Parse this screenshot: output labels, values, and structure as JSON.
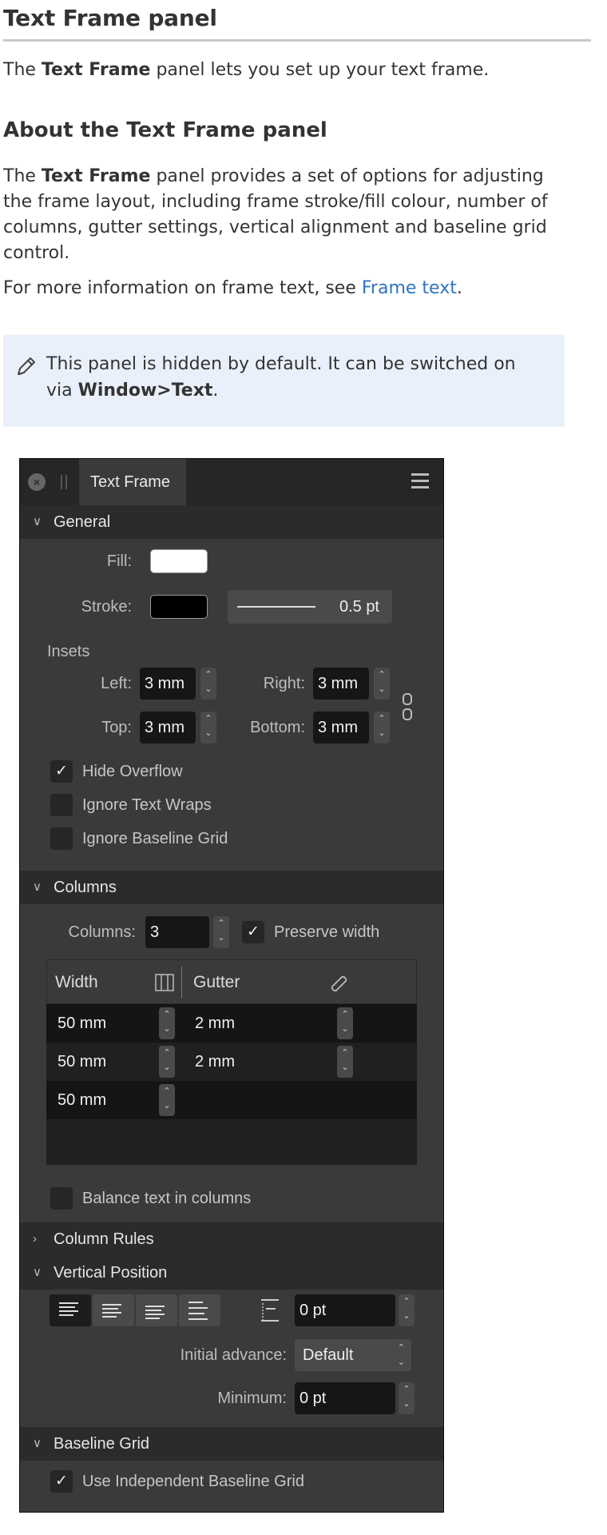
{
  "doc": {
    "title": "Text Frame panel",
    "intro_pre": "The ",
    "intro_bold": "Text Frame",
    "intro_post": " panel lets you set up your text frame.",
    "about_heading": "About the Text Frame panel",
    "about_pre": "The ",
    "about_bold": "Text Frame",
    "about_l1": " panel provides a set of options for adjusting",
    "about_l2": "the frame layout, including frame stroke/fill colour, number of",
    "about_l3": "columns, gutter settings, vertical alignment and baseline grid",
    "about_l4": "control.",
    "more_pre": "For more information on frame text, see ",
    "more_link": "Frame text",
    "more_post": ".",
    "note_l1": "This panel is hidden by default. It can be switched on",
    "note_pre": "via ",
    "note_bold": "Window>Text",
    "note_post": "."
  },
  "panel": {
    "tab_label": "Text Frame",
    "general": {
      "header": "General",
      "fill_label": "Fill:",
      "fill_color": "#ffffff",
      "stroke_label": "Stroke:",
      "stroke_color": "#000000",
      "stroke_width": "0.5 pt",
      "insets_label": "Insets",
      "left_label": "Left:",
      "left_value": "3 mm",
      "right_label": "Right:",
      "right_value": "3 mm",
      "top_label": "Top:",
      "top_value": "3 mm",
      "bottom_label": "Bottom:",
      "bottom_value": "3 mm",
      "hide_overflow": "Hide Overflow",
      "ignore_wraps": "Ignore Text Wraps",
      "ignore_baseline": "Ignore Baseline Grid"
    },
    "columns": {
      "header": "Columns",
      "columns_label": "Columns:",
      "columns_value": "3",
      "preserve_width": "Preserve width",
      "width_header": "Width",
      "gutter_header": "Gutter",
      "rows": [
        {
          "width": "50 mm",
          "gutter": "2 mm"
        },
        {
          "width": "50 mm",
          "gutter": "2 mm"
        },
        {
          "width": "50 mm",
          "gutter": ""
        }
      ],
      "balance": "Balance text in columns"
    },
    "column_rules": {
      "header": "Column Rules"
    },
    "vertical_position": {
      "header": "Vertical Position",
      "offset_value": "0 pt",
      "initial_advance_label": "Initial advance:",
      "initial_advance_value": "Default",
      "minimum_label": "Minimum:",
      "minimum_value": "0 pt"
    },
    "baseline_grid": {
      "header": "Baseline Grid",
      "use_independent": "Use Independent Baseline Grid"
    }
  }
}
